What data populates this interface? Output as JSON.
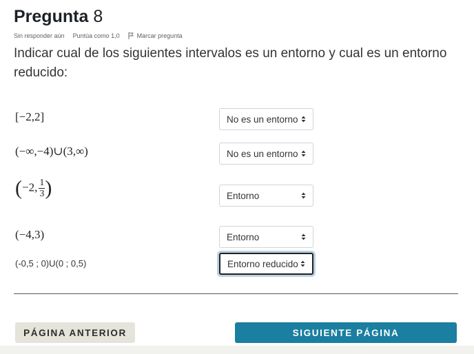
{
  "question": {
    "title_word": "Pregunta",
    "number": "8",
    "status": "Sin responder aún",
    "score": "Puntúa como 1,0",
    "flag_label": "Marcar pregunta",
    "text": "Indicar cual de los siguientes intervalos es un entorno y cual es un entorno reducido:"
  },
  "rows": [
    {
      "interval_text": "[−2,2]",
      "selected": "No es un entorno"
    },
    {
      "interval_text": "(−∞,−4)∪(3,∞)",
      "selected": "No es un entorno"
    },
    {
      "interval_prefix": "−2,",
      "frac_num": "1",
      "frac_den": "3",
      "selected": "Entorno"
    },
    {
      "interval_text": "(−4,3)",
      "selected": "Entorno"
    },
    {
      "interval_text": "(-0,5 ; 0)U(0 ; 0,5)",
      "selected": "Entorno reducido"
    }
  ],
  "nav": {
    "prev_label": "PÁGINA ANTERIOR",
    "next_label": "SIGUIENTE PÁGINA"
  },
  "colors": {
    "next_button": "#1a7fa0",
    "prev_button": "#e5e4da"
  }
}
